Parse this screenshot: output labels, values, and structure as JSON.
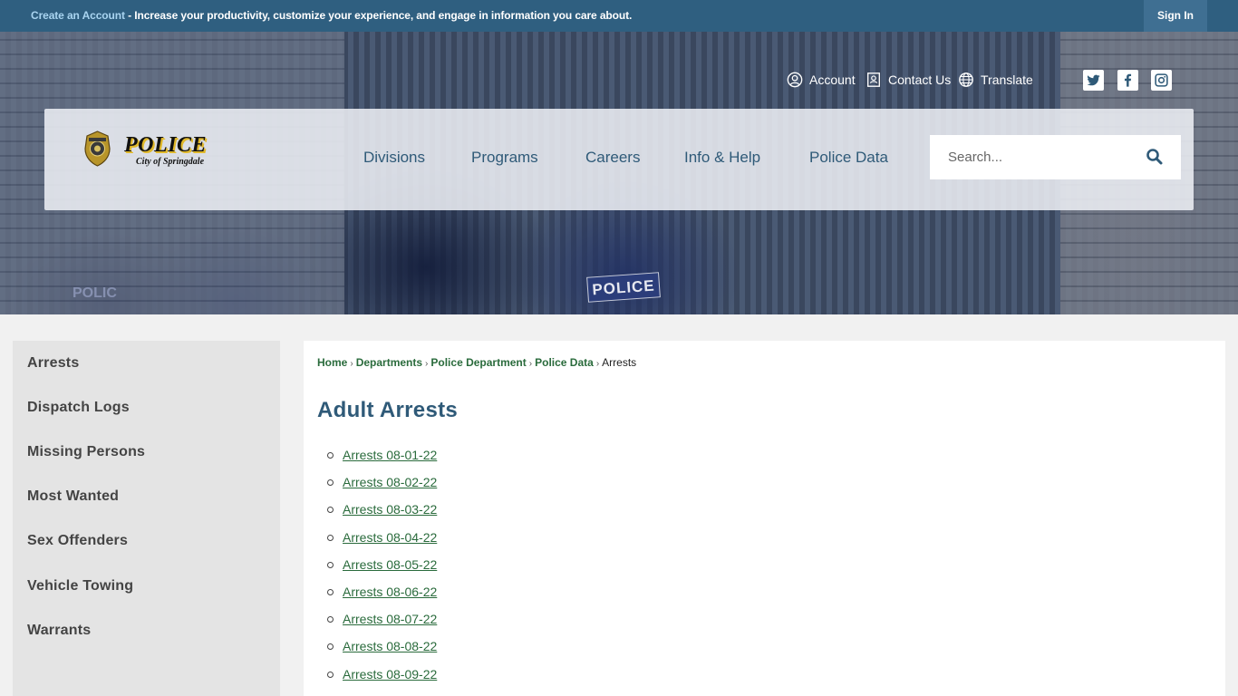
{
  "topbar": {
    "create_account_link": "Create an Account",
    "message": " - Increase your productivity, customize your experience, and engage in information you care about.",
    "sign_in": "Sign In"
  },
  "hero": {
    "patch_text": "POLICE",
    "patch_text_2": "POLIC"
  },
  "utility_links": {
    "account": "Account",
    "contact_us": "Contact Us",
    "translate": "Translate"
  },
  "social": [
    "twitter-icon",
    "facebook-icon",
    "instagram-icon"
  ],
  "logo": {
    "word": "POLICE",
    "sub": "City of Springdale"
  },
  "nav": {
    "items": [
      "Divisions",
      "Programs",
      "Careers",
      "Info & Help",
      "Police Data"
    ]
  },
  "search": {
    "placeholder": "Search..."
  },
  "sidebar": {
    "items": [
      "Arrests",
      "Dispatch Logs",
      "Missing Persons",
      "Most Wanted",
      "Sex Offenders",
      "Vehicle Towing",
      "Warrants"
    ]
  },
  "breadcrumb": {
    "items": [
      "Home",
      "Departments",
      "Police Department",
      "Police Data"
    ],
    "current": "Arrests",
    "separator": "›"
  },
  "page": {
    "title": "Adult Arrests",
    "links": [
      "Arrests 08-01-22",
      "Arrests 08-02-22",
      "Arrests 08-03-22",
      "Arrests 08-04-22",
      "Arrests 08-05-22",
      "Arrests 08-06-22",
      "Arrests 08-07-22",
      "Arrests 08-08-22",
      "Arrests 08-09-22"
    ]
  },
  "colors": {
    "topbar_bg": "#2f5f80",
    "accent_blue": "#2f5a78",
    "link_green": "#2a6b3c",
    "sidebar_bg": "#e4e4e4"
  }
}
